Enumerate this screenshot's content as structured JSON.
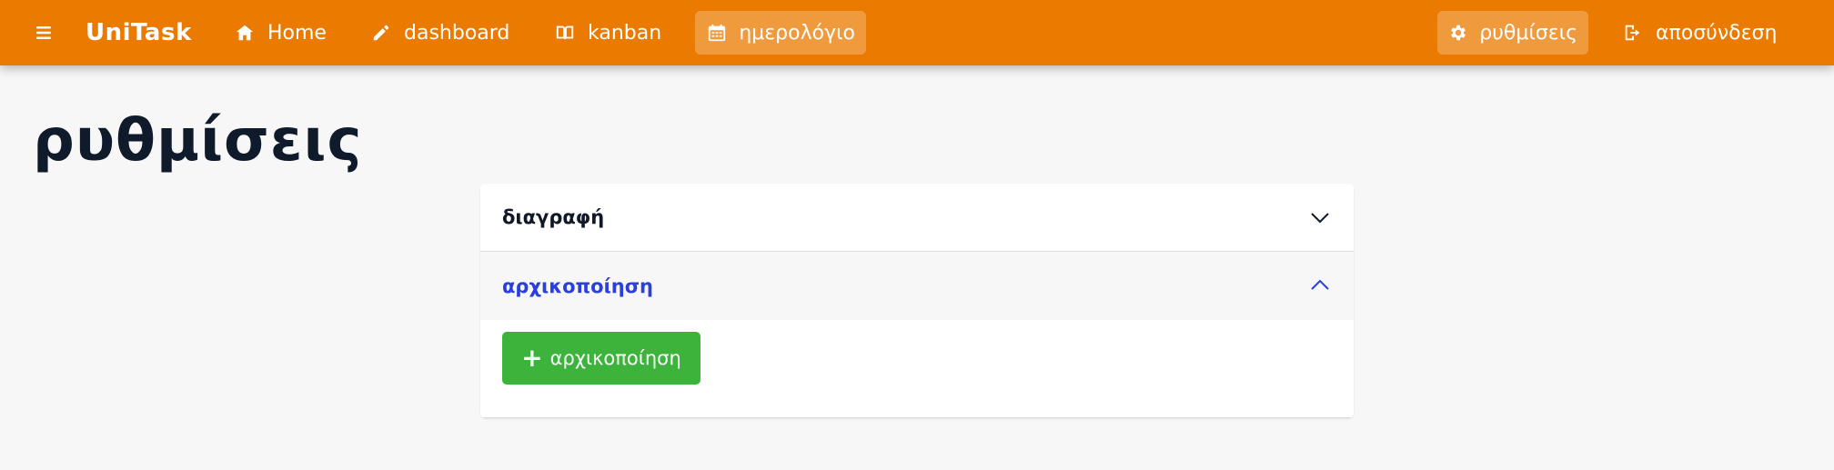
{
  "app": {
    "brand": "UniTask",
    "accent_color": "#ea7a00",
    "nav": {
      "home": {
        "label": "Home",
        "icon": "home-icon"
      },
      "dashboard": {
        "label": "dashboard",
        "icon": "pencil-icon"
      },
      "kanban": {
        "label": "kanban",
        "icon": "book-icon"
      },
      "calendar": {
        "label": "ημερολόγιο",
        "icon": "calendar-icon"
      },
      "settings": {
        "label": "ρυθμίσεις",
        "icon": "gear-icon"
      },
      "logout": {
        "label": "αποσύνδεση",
        "icon": "logout-icon"
      }
    }
  },
  "page": {
    "title": "ρυθμίσεις"
  },
  "accordion": {
    "items": [
      {
        "label": "διαγραφή",
        "expanded": false,
        "chevron": "chevron-down-icon"
      },
      {
        "label": "αρχικοποίηση",
        "expanded": true,
        "chevron": "chevron-up-icon"
      }
    ],
    "init_button": {
      "label": "αρχικοποίηση",
      "icon": "plus-icon",
      "color": "#3cb43c"
    }
  }
}
